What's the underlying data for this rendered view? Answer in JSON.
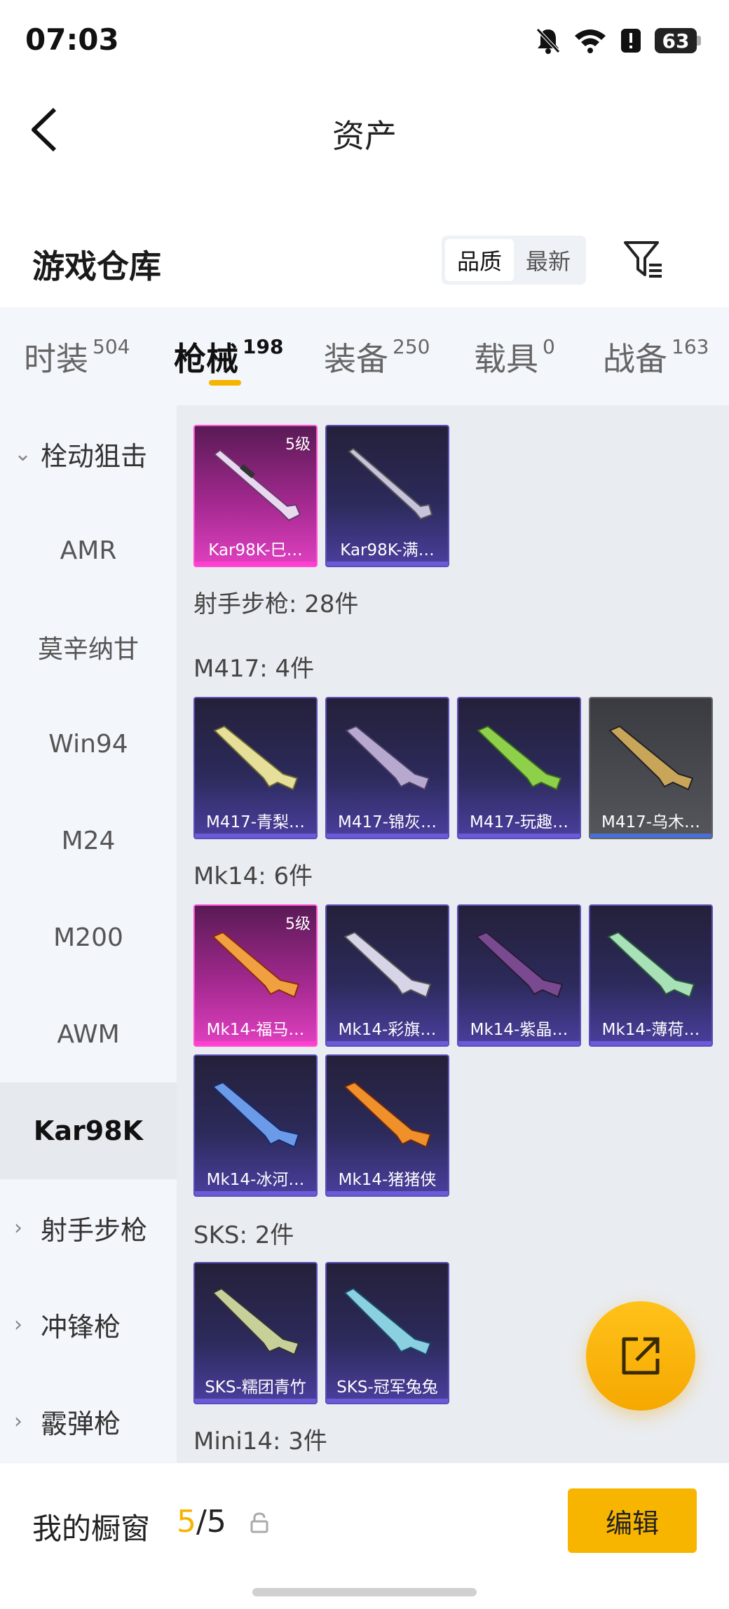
{
  "status_bar": {
    "time": "07:03",
    "battery": "63",
    "icons": [
      "bell-off-icon",
      "wifi-icon",
      "alert-icon",
      "battery-icon"
    ]
  },
  "header": {
    "title": "资产",
    "back_icon": "chevron-left-icon"
  },
  "warehouse": {
    "title": "游戏仓库",
    "sort_options": [
      {
        "label": "品质",
        "active": true
      },
      {
        "label": "最新",
        "active": false
      }
    ],
    "filter_icon": "filter-icon"
  },
  "tabs": [
    {
      "label": "时装",
      "count": "504",
      "active": false
    },
    {
      "label": "枪械",
      "count": "198",
      "active": true
    },
    {
      "label": "装备",
      "count": "250",
      "active": false
    },
    {
      "label": "载具",
      "count": "0",
      "active": false
    },
    {
      "label": "战备",
      "count": "163",
      "active": false
    }
  ],
  "sidebar": {
    "groups": [
      {
        "label": "栓动狙击",
        "expanded": true
      },
      {
        "label": "射手步枪",
        "expanded": false
      },
      {
        "label": "冲锋枪",
        "expanded": false
      },
      {
        "label": "霰弹枪",
        "expanded": false
      }
    ],
    "items": [
      {
        "label": "AMR"
      },
      {
        "label": "莫辛纳甘"
      },
      {
        "label": "Win94"
      },
      {
        "label": "M24"
      },
      {
        "label": "M200"
      },
      {
        "label": "AWM"
      },
      {
        "label": "Kar98K",
        "active": true
      }
    ]
  },
  "sections": [
    {
      "title": "",
      "items": [
        {
          "name": "Kar98K-巳…",
          "rarity": "pink",
          "level": "5级"
        },
        {
          "name": "Kar98K-满…",
          "rarity": "purple"
        }
      ]
    },
    {
      "title": "射手步枪: 28件",
      "items": []
    },
    {
      "title": "M417: 4件",
      "items": [
        {
          "name": "M417-青梨…",
          "rarity": "purple"
        },
        {
          "name": "M417-锦灰…",
          "rarity": "purple"
        },
        {
          "name": "M417-玩趣…",
          "rarity": "purple"
        },
        {
          "name": "M417-乌木…",
          "rarity": "grey"
        }
      ]
    },
    {
      "title": "Mk14: 6件",
      "items": [
        {
          "name": "Mk14-福马…",
          "rarity": "pink",
          "level": "5级"
        },
        {
          "name": "Mk14-彩旗…",
          "rarity": "purple"
        },
        {
          "name": "Mk14-紫晶…",
          "rarity": "purple"
        },
        {
          "name": "Mk14-薄荷…",
          "rarity": "purple"
        },
        {
          "name": "Mk14-冰河…",
          "rarity": "purple"
        },
        {
          "name": "Mk14-猪猪侠",
          "rarity": "purple"
        }
      ]
    },
    {
      "title": "SKS: 2件",
      "items": [
        {
          "name": "SKS-糯团青竹",
          "rarity": "purple"
        },
        {
          "name": "SKS-冠军兔兔",
          "rarity": "purple"
        }
      ]
    },
    {
      "title": "Mini14: 3件",
      "items": []
    }
  ],
  "fab": {
    "icon": "share-external-icon"
  },
  "bottom_bar": {
    "label": "我的橱窗",
    "count_current": "5",
    "count_sep": "/",
    "count_total": "5",
    "lock_icon": "lock-icon",
    "edit_label": "编辑"
  },
  "colors": {
    "accent": "#f5b400",
    "rarity_pink": "#e040c0",
    "rarity_purple": "#4a3f9e",
    "rarity_grey": "#55565c"
  }
}
